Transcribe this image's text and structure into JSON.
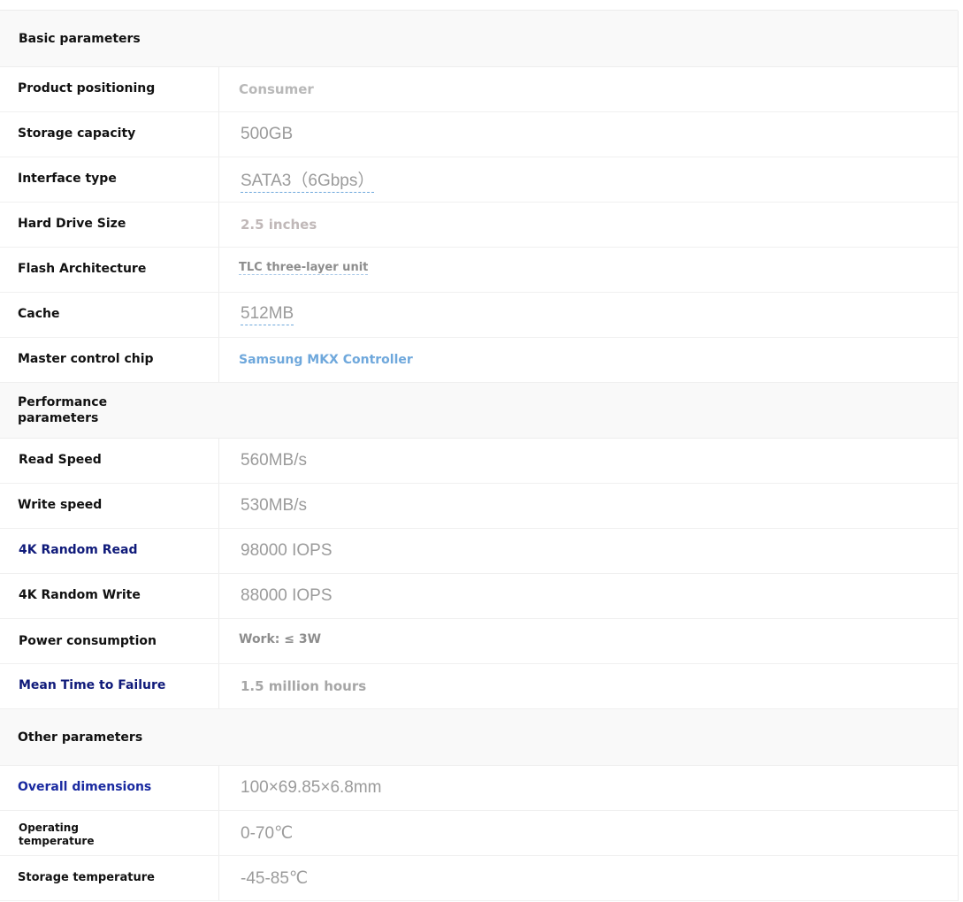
{
  "sections": [
    {
      "title": "Basic parameters",
      "rows": [
        {
          "label": "Product positioning",
          "value": "Consumer"
        },
        {
          "label": "Storage capacity",
          "value": "500GB"
        },
        {
          "label": "Interface type",
          "value": "SATA3（6Gbps）"
        },
        {
          "label": "Hard Drive Size",
          "value": "2.5 inches"
        },
        {
          "label": "Flash Architecture",
          "value": "TLC three-layer unit"
        },
        {
          "label": "Cache",
          "value": "512MB"
        },
        {
          "label": "Master control chip",
          "value": "Samsung MKX Controller"
        }
      ]
    },
    {
      "title": "Performance parameters",
      "rows": [
        {
          "label": "Read Speed",
          "value": "560MB/s"
        },
        {
          "label": "Write speed",
          "value": "530MB/s"
        },
        {
          "label": "4K Random Read",
          "value": "98000 IOPS"
        },
        {
          "label": "4K Random Write",
          "value": "88000 IOPS"
        },
        {
          "label": "Power consumption",
          "value": "Work: ≤ 3W"
        },
        {
          "label": "Mean Time to Failure",
          "value": "1.5 million hours"
        }
      ]
    },
    {
      "title": "Other parameters",
      "rows": [
        {
          "label": "Overall dimensions",
          "value": "100×69.85×6.8mm"
        },
        {
          "label": "Operating temperature",
          "value": "0-70℃"
        },
        {
          "label": "Storage temperature",
          "value": "-45-85℃"
        }
      ]
    }
  ],
  "colors": {
    "label_text": "#111111",
    "label_accent": "#0f1a7a",
    "value_gray": "#9b9b9b",
    "value_link": "#6fa8dc",
    "section_bg": "#f9f9f9"
  }
}
